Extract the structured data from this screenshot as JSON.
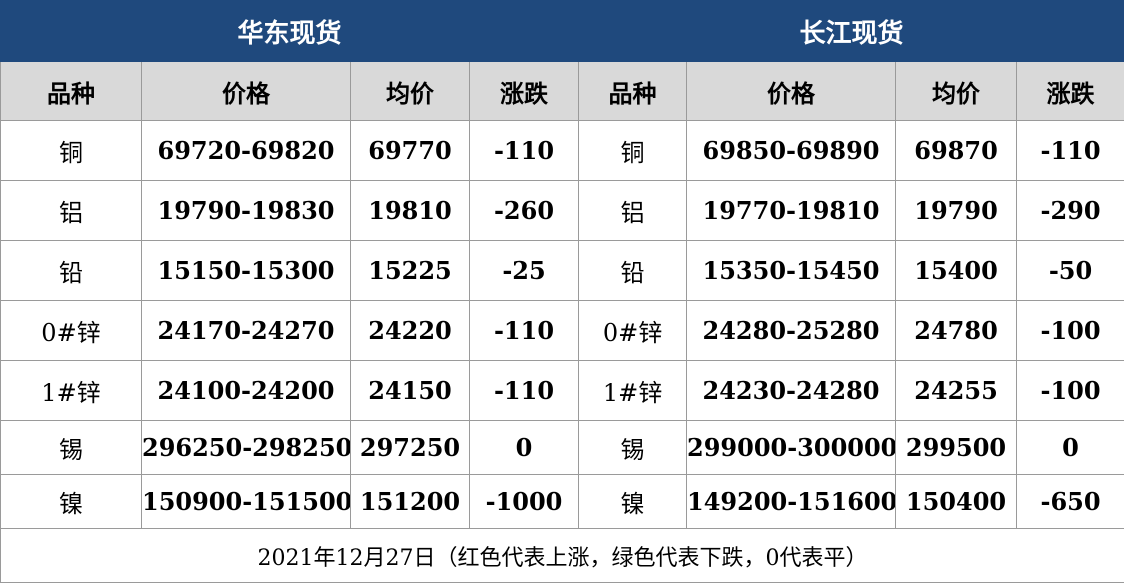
{
  "headers": {
    "east_title": "华东现货",
    "yangtze_title": "长江现货",
    "columns": [
      "品种",
      "价格",
      "均价",
      "涨跌",
      "品种",
      "价格",
      "均价",
      "涨跌"
    ]
  },
  "colors": {
    "header_bg": "#1f497d",
    "subheader_bg": "#d9d9d9",
    "fall": "#00b050",
    "flat": "#000000"
  },
  "rows": [
    {
      "e_name": "铜",
      "e_price": "69720-69820",
      "e_avg": "69770",
      "e_chg": "-110",
      "y_name": "铜",
      "y_price": "69850-69890",
      "y_avg": "69870",
      "y_chg": "-110",
      "trend": "fall"
    },
    {
      "e_name": "铝",
      "e_price": "19790-19830",
      "e_avg": "19810",
      "e_chg": "-260",
      "y_name": "铝",
      "y_price": "19770-19810",
      "y_avg": "19790",
      "y_chg": "-290",
      "trend": "fall"
    },
    {
      "e_name": "铅",
      "e_price": "15150-15300",
      "e_avg": "15225",
      "e_chg": "-25",
      "y_name": "铅",
      "y_price": "15350-15450",
      "y_avg": "15400",
      "y_chg": "-50",
      "trend": "fall"
    },
    {
      "e_name": "0#锌",
      "e_price": "24170-24270",
      "e_avg": "24220",
      "e_chg": "-110",
      "y_name": "0#锌",
      "y_price": "24280-25280",
      "y_avg": "24780",
      "y_chg": "-100",
      "trend": "fall"
    },
    {
      "e_name": "1#锌",
      "e_price": "24100-24200",
      "e_avg": "24150",
      "e_chg": "-110",
      "y_name": "1#锌",
      "y_price": "24230-24280",
      "y_avg": "24255",
      "y_chg": "-100",
      "trend": "fall"
    },
    {
      "e_name": "锡",
      "e_price": "296250-298250",
      "e_avg": "297250",
      "e_chg": "0",
      "y_name": "锡",
      "y_price": "299000-300000",
      "y_avg": "299500",
      "y_chg": "0",
      "trend": "flat"
    },
    {
      "e_name": "镍",
      "e_price": "150900-151500",
      "e_avg": "151200",
      "e_chg": "-1000",
      "y_name": "镍",
      "y_price": "149200-151600",
      "y_avg": "150400",
      "y_chg": "-650",
      "trend": "fall"
    }
  ],
  "footer": "2021年12月27日（红色代表上涨，绿色代表下跌，0代表平）"
}
